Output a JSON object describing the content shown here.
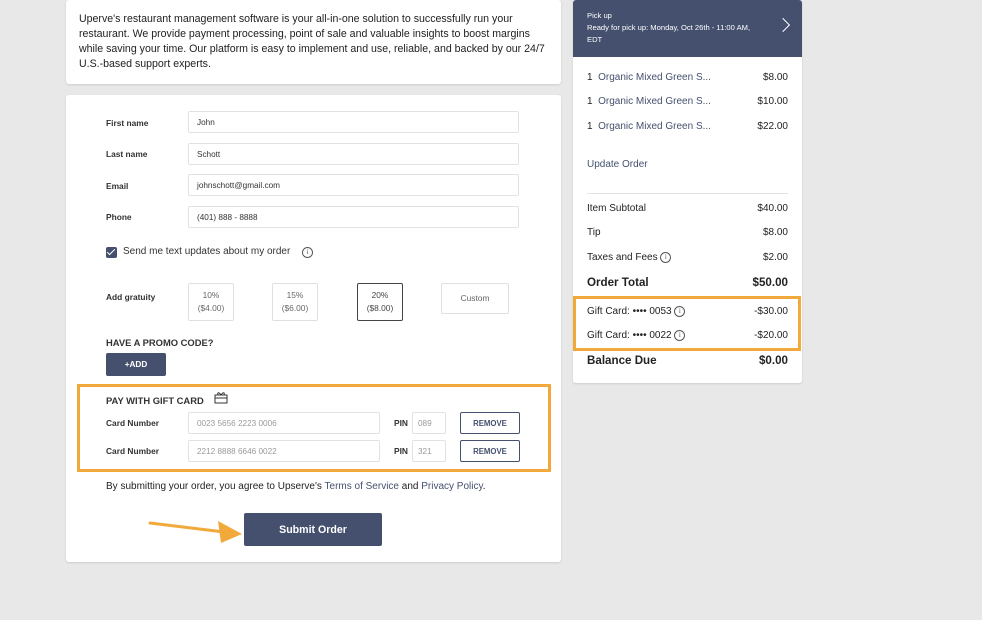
{
  "intro": {
    "text": "Uperve's restaurant management software is your all-in-one solution to successfully run your restaurant. We provide payment processing, point of sale and valuable insights to boost margins while saving your time. Our platform is easy to implement and use, reliable, and backed by our 24/7 U.S.-based support experts."
  },
  "form": {
    "first_name": {
      "label": "First name",
      "value": "John"
    },
    "last_name": {
      "label": "Last name",
      "value": "Schott"
    },
    "email": {
      "label": "Email",
      "value": "johnschott@gmail.com"
    },
    "phone": {
      "label": "Phone",
      "value": "(401) 888 - 8888"
    },
    "text_updates_label": "Send me text updates about my order",
    "gratuity": {
      "label": "Add gratuity",
      "options": [
        {
          "pct": "10%",
          "amt": "($4.00)"
        },
        {
          "pct": "15%",
          "amt": "($6.00)"
        },
        {
          "pct": "20%",
          "amt": "($8.00)"
        }
      ],
      "custom_label": "Custom",
      "selected": "20%"
    },
    "promo": {
      "heading": "HAVE A PROMO CODE?",
      "add_label": "+ADD"
    },
    "gift_card": {
      "heading": "PAY WITH GIFT CARD",
      "cards": [
        {
          "label": "Card Number",
          "number": "0023 5656 2223 0006",
          "pin_label": "PIN",
          "pin": "089",
          "remove_label": "REMOVE"
        },
        {
          "label": "Card Number",
          "number": "2212 8888 6646 0022",
          "pin_label": "PIN",
          "pin": "321",
          "remove_label": "REMOVE"
        }
      ]
    },
    "agreement": {
      "prefix": "By submitting your order, you agree to Upserve's ",
      "terms": "Terms of Service",
      "and": " and ",
      "privacy": "Privacy Policy",
      "suffix": "."
    },
    "submit_label": "Submit Order"
  },
  "summary": {
    "pickup": {
      "title": "Pick up",
      "detail": "Ready for pick up: Monday, Oct 26th - 11:00 AM, EDT"
    },
    "items": [
      {
        "qty": "1",
        "name": "Organic Mixed Green S...",
        "price": "$8.00"
      },
      {
        "qty": "1",
        "name": "Organic Mixed Green S...",
        "price": "$10.00"
      },
      {
        "qty": "1",
        "name": "Organic Mixed Green S...",
        "price": "$22.00"
      }
    ],
    "update_label": "Update Order",
    "subtotal": {
      "label": "Item Subtotal",
      "value": "$40.00"
    },
    "tip": {
      "label": "Tip",
      "value": "$8.00"
    },
    "taxes": {
      "label": "Taxes and Fees",
      "value": "$2.00"
    },
    "order_total": {
      "label": "Order Total",
      "value": "$50.00"
    },
    "gift_cards": [
      {
        "label": "Gift Card: •••• 0053",
        "value": "-$30.00"
      },
      {
        "label": "Gift Card: •••• 0022",
        "value": "-$20.00"
      }
    ],
    "balance": {
      "label": "Balance Due",
      "value": "$0.00"
    }
  },
  "colors": {
    "accent": "#44506e",
    "highlight": "#f2a93b",
    "background": "#e8e8e8"
  }
}
